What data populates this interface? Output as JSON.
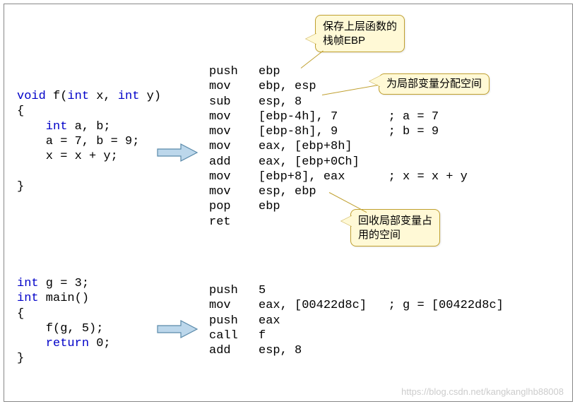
{
  "callouts": {
    "c1": "保存上层函数的\n栈帧EBP",
    "c2": "为局部变量分配空间",
    "c3": "回收局部变量占\n用的空间"
  },
  "c_code_f": [
    {
      "t": "void",
      "c": "kw"
    },
    {
      "t": " f(",
      "c": "plain"
    },
    {
      "t": "int",
      "c": "kw"
    },
    {
      "t": " x, ",
      "c": "plain"
    },
    {
      "t": "int",
      "c": "kw"
    },
    {
      "t": " y)",
      "c": "plain"
    },
    {
      "t": "\n",
      "c": "plain"
    },
    {
      "t": "{",
      "c": "plain"
    },
    {
      "t": "\n",
      "c": "plain"
    },
    {
      "t": "    int",
      "c": "kw"
    },
    {
      "t": " a, b;",
      "c": "plain"
    },
    {
      "t": "\n",
      "c": "plain"
    },
    {
      "t": "    a = 7, b = 9;",
      "c": "plain"
    },
    {
      "t": "\n",
      "c": "plain"
    },
    {
      "t": "    x = x + y;",
      "c": "plain"
    },
    {
      "t": "\n",
      "c": "plain"
    },
    {
      "t": "\n",
      "c": "plain"
    },
    {
      "t": "}",
      "c": "plain"
    }
  ],
  "asm_f": [
    {
      "op": "push",
      "arg": "ebp",
      "cmt": ""
    },
    {
      "op": "mov",
      "arg": "ebp, esp",
      "cmt": ""
    },
    {
      "op": "sub",
      "arg": "esp, 8",
      "cmt": ""
    },
    {
      "op": "mov",
      "arg": "[ebp-4h], 7",
      "cmt": "; a = 7"
    },
    {
      "op": "mov",
      "arg": "[ebp-8h], 9",
      "cmt": "; b = 9"
    },
    {
      "op": "mov",
      "arg": "eax, [ebp+8h]",
      "cmt": ""
    },
    {
      "op": "add",
      "arg": "eax, [ebp+0Ch]",
      "cmt": ""
    },
    {
      "op": "mov",
      "arg": "[ebp+8], eax",
      "cmt": "; x = x + y"
    },
    {
      "op": "mov",
      "arg": "esp, ebp",
      "cmt": ""
    },
    {
      "op": "pop",
      "arg": "ebp",
      "cmt": ""
    },
    {
      "op": "ret",
      "arg": "",
      "cmt": ""
    }
  ],
  "c_code_main": [
    {
      "t": "int",
      "c": "kw"
    },
    {
      "t": " g = 3;",
      "c": "plain"
    },
    {
      "t": "\n",
      "c": "plain"
    },
    {
      "t": "int",
      "c": "kw"
    },
    {
      "t": " main()",
      "c": "plain"
    },
    {
      "t": "\n",
      "c": "plain"
    },
    {
      "t": "{",
      "c": "plain"
    },
    {
      "t": "\n",
      "c": "plain"
    },
    {
      "t": "    f(g, 5);",
      "c": "plain"
    },
    {
      "t": "\n",
      "c": "plain"
    },
    {
      "t": "    return",
      "c": "kw"
    },
    {
      "t": " 0;",
      "c": "plain"
    },
    {
      "t": "\n",
      "c": "plain"
    },
    {
      "t": "}",
      "c": "plain"
    }
  ],
  "asm_main": [
    {
      "op": "push",
      "arg": "5",
      "cmt": ""
    },
    {
      "op": "mov",
      "arg": "eax, [00422d8c]",
      "cmt": "; g = [00422d8c]"
    },
    {
      "op": "push",
      "arg": "eax",
      "cmt": ""
    },
    {
      "op": "call",
      "arg": "f",
      "cmt": ""
    },
    {
      "op": "add",
      "arg": "esp, 8",
      "cmt": ""
    }
  ],
  "watermark": "https://blog.csdn.net/kangkanglhb88008"
}
